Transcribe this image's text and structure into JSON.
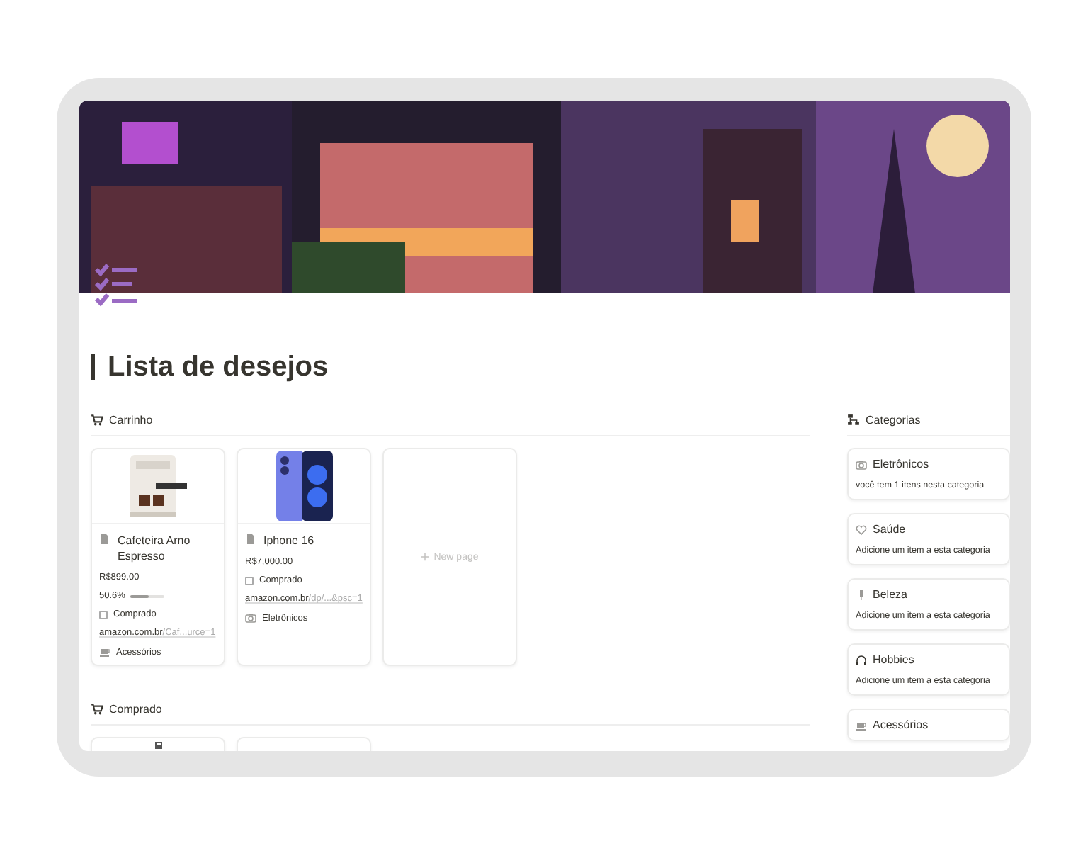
{
  "title": "Lista de desejos",
  "sections": [
    {
      "title": "Carrinho",
      "cards": [
        {
          "kind": "product",
          "name": "Cafeteira Arno Espresso",
          "price": "R$899.00",
          "progress": {
            "reading": "50.6%",
            "level": 0.506
          },
          "bought": false,
          "bought_label": "Comprado",
          "link": {
            "host": "amazon.com.br",
            "path": "/Caf...urce=1"
          },
          "category": "Acessórios"
        },
        {
          "kind": "product",
          "name": "Iphone 16",
          "price": "R$7,000.00",
          "bought": false,
          "bought_label": "Comprado",
          "link": {
            "host": "amazon.com.br",
            "path": "/dp/...&psc=1"
          },
          "category": "Eletrônicos"
        },
        {
          "kind": "new",
          "label": "New page"
        }
      ]
    },
    {
      "title": "Comprado",
      "cards": [
        {
          "kind": "cut_picture"
        },
        {
          "kind": "cut_blank"
        }
      ]
    }
  ],
  "categories": {
    "title": "Categorias",
    "items": [
      {
        "name": "Eletrônicos",
        "description": "você tem 1 itens nesta categoria"
      },
      {
        "name": "Saúde",
        "description": "Adicione um item a esta categoria"
      },
      {
        "name": "Beleza",
        "description": "Adicione um item a esta categoria"
      },
      {
        "name": "Hobbies",
        "description": "Adicione um item a esta categoria"
      },
      {
        "name": "Acessórios"
      }
    ]
  }
}
